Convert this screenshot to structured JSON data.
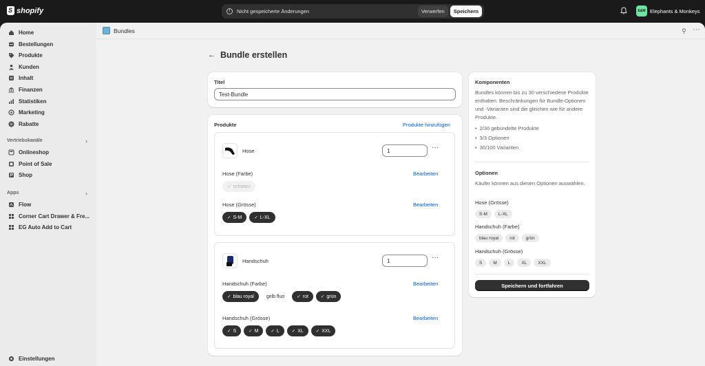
{
  "topbar": {
    "brand": "shopify",
    "unsaved_message": "Nicht gespeicherte Änderungen",
    "discard_label": "Verwerfen",
    "save_label": "Speichern",
    "store_initials": "E&M",
    "store_name": "Elephants & Monkeys",
    "store_color": "#6fe3a3"
  },
  "sidebar": {
    "items": [
      {
        "label": "Home",
        "icon": "home-icon"
      },
      {
        "label": "Bestellungen",
        "icon": "inbox-icon"
      },
      {
        "label": "Produkte",
        "icon": "tag-icon"
      },
      {
        "label": "Kunden",
        "icon": "person-icon"
      },
      {
        "label": "Inhalt",
        "icon": "content-icon"
      },
      {
        "label": "Finanzen",
        "icon": "bank-icon"
      },
      {
        "label": "Statistiken",
        "icon": "chart-icon"
      },
      {
        "label": "Marketing",
        "icon": "target-icon"
      },
      {
        "label": "Rabatte",
        "icon": "discount-icon"
      }
    ],
    "sales_channels_title": "Vertriebskanäle",
    "sales_channels": [
      {
        "label": "Onlineshop",
        "icon": "store-icon"
      },
      {
        "label": "Point of Sale",
        "icon": "pos-icon"
      },
      {
        "label": "Shop",
        "icon": "shop-icon"
      }
    ],
    "apps_title": "Apps",
    "apps": [
      {
        "label": "Flow",
        "icon": "flow-icon"
      },
      {
        "label": "Corner Cart Drawer & Fre...",
        "icon": "app-icon"
      },
      {
        "label": "EG Auto Add to Cart",
        "icon": "app-icon"
      }
    ],
    "settings_label": "Einstellungen"
  },
  "app_header": {
    "title": "Bundles"
  },
  "page": {
    "title": "Bundle erstellen"
  },
  "title_card": {
    "label": "Titel",
    "value": "Test-Bundle"
  },
  "products_card": {
    "label": "Produkte",
    "add_link": "Produkte hinzufügen",
    "products": [
      {
        "name": "Hose",
        "quantity": "1",
        "options": [
          {
            "label": "Hose (Farbe)",
            "edit": "Bearbeiten",
            "values": [
              {
                "text": "schwarz",
                "state": "disabled"
              }
            ]
          },
          {
            "label": "Hose (Grösse)",
            "edit": "Bearbeiten",
            "values": [
              {
                "text": "S-M",
                "state": "on"
              },
              {
                "text": "L-XL",
                "state": "on"
              }
            ]
          }
        ]
      },
      {
        "name": "Handschuh",
        "quantity": "1",
        "options": [
          {
            "label": "Handschuh (Farbe)",
            "edit": "Bearbeiten",
            "values": [
              {
                "text": "blau royal",
                "state": "on"
              },
              {
                "text": "gelb fluo",
                "state": "off"
              },
              {
                "text": "rot",
                "state": "on"
              },
              {
                "text": "grün",
                "state": "on"
              }
            ]
          },
          {
            "label": "Handschuh (Grösse)",
            "edit": "Bearbeiten",
            "values": [
              {
                "text": "S",
                "state": "on"
              },
              {
                "text": "M",
                "state": "on"
              },
              {
                "text": "L",
                "state": "on"
              },
              {
                "text": "XL",
                "state": "on"
              },
              {
                "text": "XXL",
                "state": "on"
              }
            ]
          }
        ]
      }
    ]
  },
  "components_card": {
    "title": "Komponenten",
    "description": "Bundles können bis zu 30 verschiedene Produkte enthalten. Beschränkungen für Bundle-Optionen und -Varianten sind die gleichen wie für andere Produkte.",
    "limits": [
      "2/30 gebündelte Produkte",
      "3/3 Optionen",
      "30/100 Varianten"
    ],
    "options_title": "Optionen",
    "options_description": "Käufer können aus diesen Optionen auswählen.",
    "option_groups": [
      {
        "label": "Hose (Grösse)",
        "values": [
          "S-M",
          "L-XL"
        ]
      },
      {
        "label": "Handschuh (Farbe)",
        "values": [
          "blau royal",
          "rot",
          "grün"
        ]
      },
      {
        "label": "Handschuh (Grösse)",
        "values": [
          "S",
          "M",
          "L",
          "XL",
          "XXL"
        ]
      }
    ],
    "primary_button": "Speichern und fortfahren"
  }
}
